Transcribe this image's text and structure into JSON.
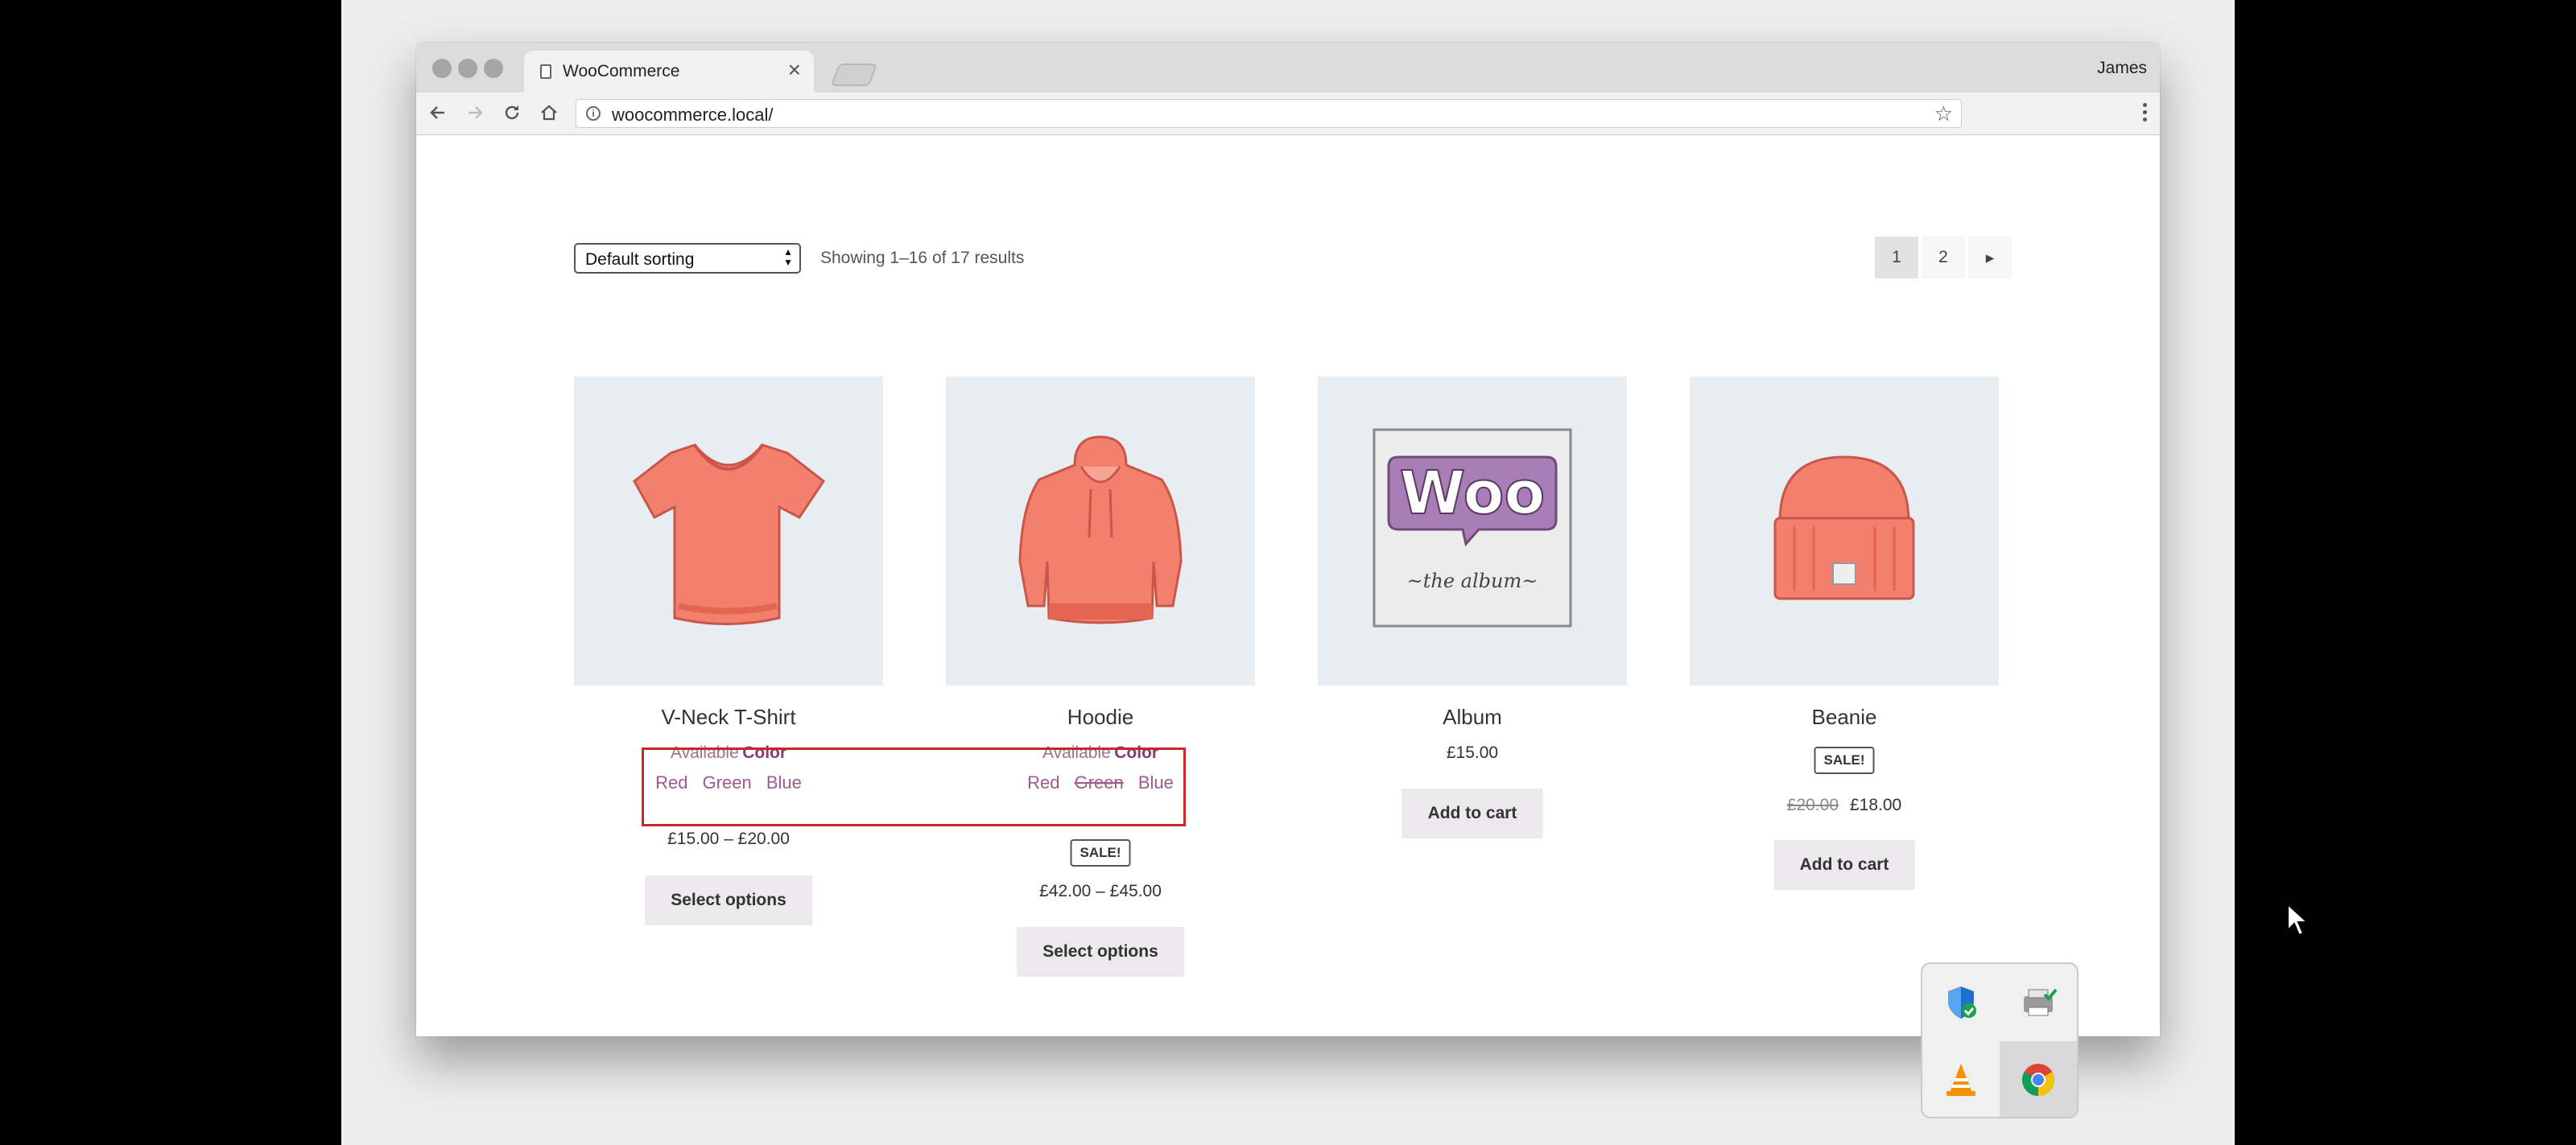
{
  "browser": {
    "tab_title": "WooCommerce",
    "profile_name": "James",
    "url": "woocommerce.local/",
    "icons": [
      "back-icon",
      "forward-icon",
      "reload-icon",
      "home-icon",
      "info-icon",
      "star-icon",
      "menu-icon"
    ]
  },
  "shop": {
    "sorting": "Default sorting",
    "result_count": "Showing 1–16 of 17 results",
    "pages": [
      "1",
      "2"
    ],
    "next_icon": "▸",
    "products": [
      {
        "name": "V-Neck T-Shirt",
        "available": "Available",
        "attribute": "Color",
        "colors": [
          "Red",
          "Green",
          "Blue"
        ],
        "price": "£15.00 – £20.00",
        "button": "Select options"
      },
      {
        "name": "Hoodie",
        "available": "Available",
        "attribute": "Color",
        "colors": [
          "Red",
          "Green",
          "Blue"
        ],
        "unavailable_color": "Green",
        "sale_badge": "SALE!",
        "price": "£42.00 – £45.00",
        "button": "Select options"
      },
      {
        "name": "Album",
        "price": "£15.00",
        "button": "Add to cart",
        "album_logo": "Woo",
        "album_caption": "~the album~"
      },
      {
        "name": "Beanie",
        "sale_badge": "SALE!",
        "old_price": "£20.00",
        "price": "£18.00",
        "button": "Add to cart"
      }
    ]
  },
  "tray": {
    "icons": [
      "shield-check-icon",
      "printer-check-icon",
      "vlc-cone-icon",
      "chrome-icon"
    ]
  },
  "colors": {
    "accent_purple": "#a46497",
    "highlight_red": "#c62828",
    "product_pink": "#f2806c",
    "thumb_bg": "#e8edf1"
  }
}
